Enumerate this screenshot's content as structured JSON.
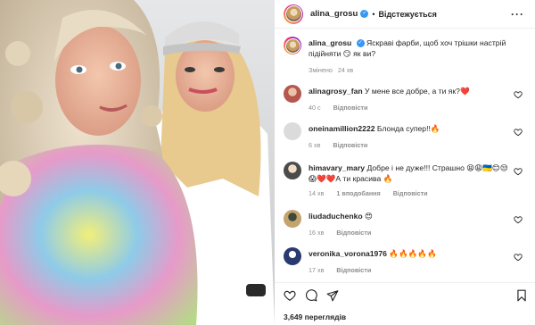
{
  "header": {
    "username": "alina_grosu",
    "follow_label": "Відстежується"
  },
  "caption": {
    "username": "alina_grosu",
    "text": "Яскраві фарби, щоб хоч трішки настрій підійняти 😏 як ви?",
    "edited_label": "Змінено",
    "time": "24 хв"
  },
  "comments": [
    {
      "username": "alinagrosy_fan",
      "text": "У мене все добре, а ти як?❤️",
      "likes": "40 с",
      "reply_label": "Відповісти"
    },
    {
      "username": "oneinamillion2222",
      "text": "Блонда супер!!🔥",
      "likes": "6 хв",
      "reply_label": "Відповісти"
    },
    {
      "username": "himavary_mary",
      "text": "Добре і не дуже!!! Страшно 😫😩🇺🇦😊😒😱❤️❤️А ти красива 🔥",
      "likes": "14 хв",
      "likes_count": "1 вподобання",
      "reply_label": "Відповісти"
    },
    {
      "username": "liudaduchenko",
      "text": "😍",
      "likes": "16 хв",
      "reply_label": "Відповісти"
    },
    {
      "username": "veronika_vorona1976",
      "text": "🔥🔥🔥🔥🔥",
      "likes": "17 хв",
      "reply_label": "Відповісти"
    }
  ],
  "footer": {
    "views_count": "3,649",
    "views_label": "переглядів"
  },
  "icons": [
    "verified-badge-icon",
    "more-options-icon",
    "heart-icon",
    "comment-icon",
    "share-icon",
    "bookmark-icon"
  ],
  "colors": {
    "verified": "#3897f0",
    "muted": "#8e8e8e",
    "text": "#262626"
  }
}
